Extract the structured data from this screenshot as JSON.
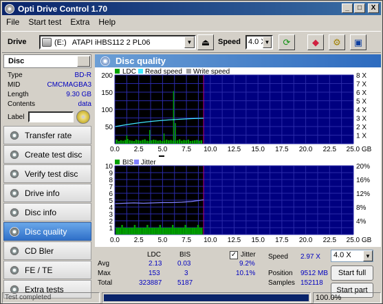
{
  "window": {
    "title": "Opti Drive Control 1.70",
    "buttons": [
      "_",
      "□",
      "X"
    ]
  },
  "menu": [
    "File",
    "Start test",
    "Extra",
    "Help"
  ],
  "toolbar": {
    "drive_label": "Drive",
    "drive_letter": "(E:)",
    "drive_name": "ATAPI  iHBS112   2 PL06",
    "speed_label": "Speed",
    "speed_value": "4.0 X"
  },
  "disc": {
    "header": "Disc",
    "fields": [
      {
        "k": "Type",
        "v": "BD-R"
      },
      {
        "k": "MID",
        "v": "CMCMAGBA3"
      },
      {
        "k": "Length",
        "v": "9.30 GB"
      },
      {
        "k": "Contents",
        "v": "data"
      }
    ],
    "label_text": "Label"
  },
  "nav": [
    "Transfer rate",
    "Create test disc",
    "Verify test disc",
    "Drive info",
    "Disc info",
    "Disc quality",
    "CD Bler",
    "FE / TE",
    "Extra tests"
  ],
  "panel": {
    "title": "Disc quality"
  },
  "colors": {
    "ldc": "#00a000",
    "read": "#40e8ff",
    "write": "#a0a0a0",
    "bis": "#00a000",
    "jitter": "#8080ff",
    "plot_bg": "#000080",
    "marker": "#c00080"
  },
  "chart_data": [
    {
      "type": "bar",
      "legend": [
        "LDC",
        "Read speed",
        "Write speed"
      ],
      "xlim": [
        0,
        25
      ],
      "x_ticks": [
        "0.0",
        "2.5",
        "5.0",
        "7.5",
        "10.0",
        "12.5",
        "15.0",
        "17.5",
        "20.0",
        "22.5",
        "25.0 GB"
      ],
      "ylim": [
        0,
        200
      ],
      "y_ticks": [
        "200",
        "150",
        "100",
        "50"
      ],
      "y2_ticks": [
        "8 X",
        "7 X",
        "6 X",
        "5 X",
        "4 X",
        "3 X",
        "2 X",
        "1 X"
      ],
      "scanned_to_gb": 9.3,
      "ldc_base": [
        12,
        8,
        10,
        9,
        11,
        14,
        10,
        9,
        8,
        12,
        10,
        9,
        11,
        13,
        9,
        8,
        10,
        12,
        11,
        9,
        10,
        8,
        9,
        12,
        10,
        11,
        9,
        8,
        10,
        13,
        9,
        11,
        10,
        12,
        8,
        9,
        10,
        11,
        9,
        10
      ],
      "ldc_spikes": [
        {
          "x": 3.6,
          "y": 40
        },
        {
          "x": 5.1,
          "y": 30
        },
        {
          "x": 6.1,
          "y": 153
        },
        {
          "x": 6.3,
          "y": 60
        },
        {
          "x": 1.2,
          "y": 25
        }
      ],
      "read_speed": [
        [
          0.05,
          2.0
        ],
        [
          1,
          2.18
        ],
        [
          2,
          2.35
        ],
        [
          3,
          2.5
        ],
        [
          4,
          2.62
        ],
        [
          5,
          2.72
        ],
        [
          6,
          2.8
        ],
        [
          7,
          2.86
        ],
        [
          8,
          2.92
        ],
        [
          9.3,
          2.97
        ]
      ]
    },
    {
      "type": "bar",
      "legend": [
        "BIS",
        "Jitter"
      ],
      "xlim": [
        0,
        25
      ],
      "x_ticks": [
        "0.0",
        "2.5",
        "5.0",
        "7.5",
        "10.0",
        "12.5",
        "15.0",
        "17.5",
        "20.0",
        "22.5",
        "25.0 GB"
      ],
      "ylim": [
        0,
        10
      ],
      "y_ticks": [
        "10",
        "9",
        "8",
        "7",
        "6",
        "5",
        "4",
        "3",
        "2",
        "1"
      ],
      "y2_ticks": [
        "20%",
        "16%",
        "12%",
        "8%",
        "4%"
      ],
      "bis_level": 1.0,
      "jitter": [
        [
          0.05,
          9.0
        ],
        [
          1,
          9.1
        ],
        [
          2,
          9.2
        ],
        [
          3,
          9.1
        ],
        [
          4,
          9.2
        ],
        [
          5,
          9.3
        ],
        [
          6,
          9.3
        ],
        [
          7,
          9.4
        ],
        [
          8,
          9.6
        ],
        [
          9.3,
          10.1
        ]
      ]
    }
  ],
  "stats": {
    "col_ldc": "LDC",
    "col_bis": "BIS",
    "jitter_label": "Jitter",
    "rows": [
      {
        "label": "Avg",
        "ldc": "2.13",
        "bis": "0.03",
        "jitter": "9.2%"
      },
      {
        "label": "Max",
        "ldc": "153",
        "bis": "3",
        "jitter": "10.1%"
      },
      {
        "label": "Total",
        "ldc": "323887",
        "bis": "5187",
        "jitter": ""
      }
    ],
    "speed_label": "Speed",
    "speed_value": "2.97 X",
    "position_label": "Position",
    "position_value": "9512 MB",
    "samples_label": "Samples",
    "samples_value": "152118",
    "speed_select": "4.0 X",
    "start_full": "Start full",
    "start_part": "Start part"
  },
  "status": {
    "left": "Test completed",
    "progress_text": "100.0%",
    "progress": 1.0
  }
}
